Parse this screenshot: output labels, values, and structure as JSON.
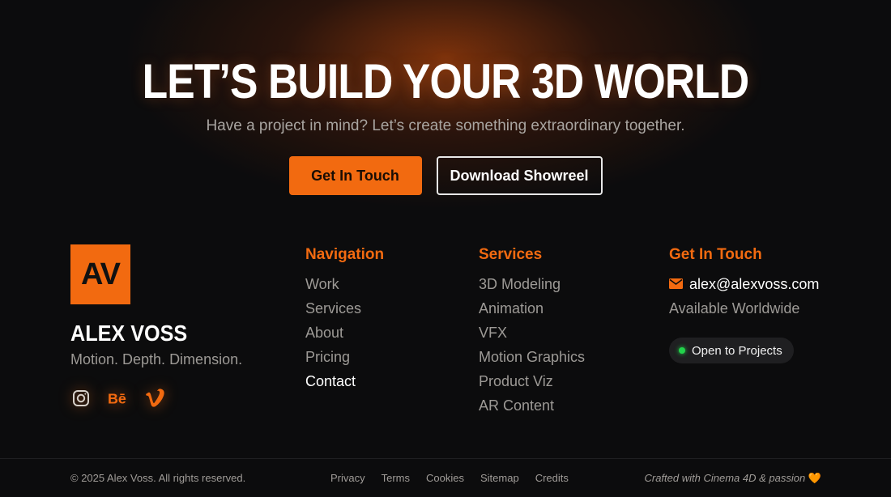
{
  "hero": {
    "title": "LET’S BUILD YOUR 3D WORLD",
    "subtitle": "Have a project in mind? Let’s create something extraordinary together.",
    "primary_cta": "Get In Touch",
    "secondary_cta": "Download Showreel"
  },
  "brand": {
    "logo_text": "AV",
    "name": "ALEX VOSS",
    "tagline": "Motion. Depth. Dimension.",
    "socials": [
      "instagram-icon",
      "behance-icon",
      "vimeo-icon"
    ]
  },
  "navigation": {
    "heading": "Navigation",
    "items": [
      "Work",
      "Services",
      "About",
      "Pricing",
      "Contact"
    ]
  },
  "services": {
    "heading": "Services",
    "items": [
      "3D Modeling",
      "Animation",
      "VFX",
      "Motion Graphics",
      "Product Viz",
      "AR Content"
    ]
  },
  "contact": {
    "heading": "Get In Touch",
    "email": "alex@alexvoss.com",
    "availability": "Available Worldwide",
    "status": "Open to Projects"
  },
  "footer": {
    "copyright": "© 2025 Alex Voss. All rights reserved.",
    "links": [
      "Privacy",
      "Terms",
      "Cookies",
      "Sitemap",
      "Credits"
    ],
    "crafted": "Crafted with Cinema 4D & passion",
    "heart": "🧡"
  },
  "colors": {
    "accent": "#f26a10",
    "background": "#0c0c0d",
    "status_green": "#22d34b"
  }
}
